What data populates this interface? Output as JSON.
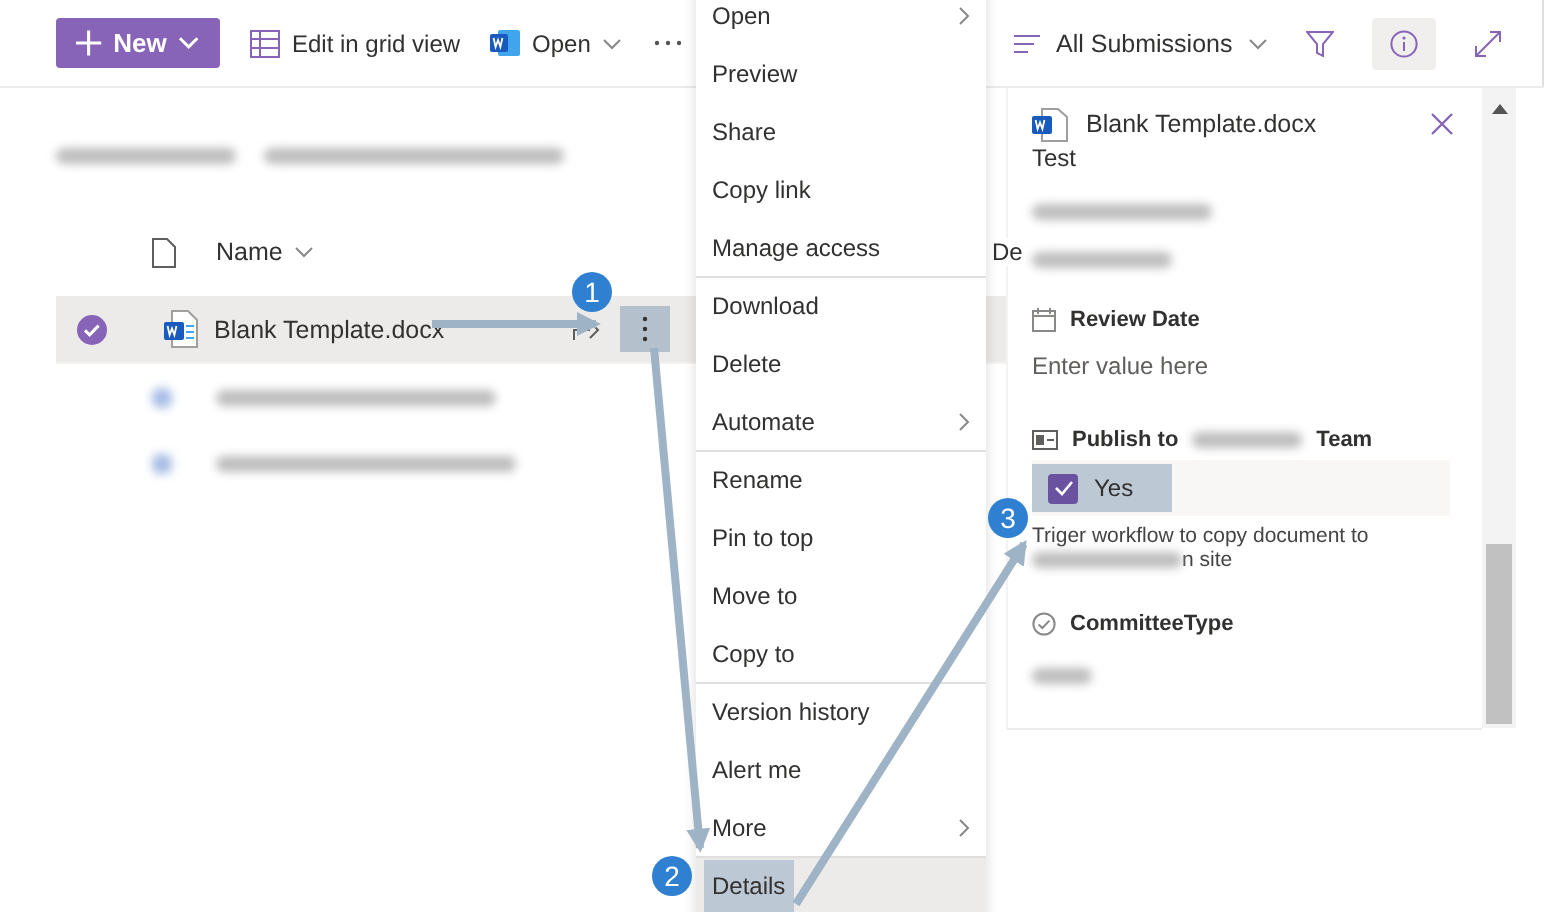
{
  "command_bar": {
    "new_button": {
      "label": "New"
    },
    "commands": [
      {
        "label": "Edit in grid view",
        "kind": "grid"
      },
      {
        "label": "Open",
        "kind": "word"
      }
    ]
  },
  "view_bar": {
    "view": "All Submissions",
    "info_selected": true
  },
  "list": {
    "columns": [
      {
        "label": "Name"
      },
      {
        "label": "De"
      }
    ],
    "rows": [
      {
        "name": "Blank Template.docx",
        "selected": true
      }
    ]
  },
  "context_menu": {
    "items": [
      {
        "label": "Open",
        "submenu": true,
        "divider_before": false,
        "selected": false
      },
      {
        "label": "Preview",
        "submenu": false,
        "divider_before": false,
        "selected": false
      },
      {
        "label": "Share",
        "submenu": false,
        "divider_before": false,
        "selected": false
      },
      {
        "label": "Copy link",
        "submenu": false,
        "divider_before": false,
        "selected": false
      },
      {
        "label": "Manage access",
        "submenu": false,
        "divider_before": false,
        "selected": false
      },
      {
        "label": "Download",
        "submenu": false,
        "divider_before": true,
        "selected": false
      },
      {
        "label": "Delete",
        "submenu": false,
        "divider_before": false,
        "selected": false
      },
      {
        "label": "Automate",
        "submenu": true,
        "divider_before": false,
        "selected": false
      },
      {
        "label": "Rename",
        "submenu": false,
        "divider_before": true,
        "selected": false
      },
      {
        "label": "Pin to top",
        "submenu": false,
        "divider_before": false,
        "selected": false
      },
      {
        "label": "Move to",
        "submenu": false,
        "divider_before": false,
        "selected": false
      },
      {
        "label": "Copy to",
        "submenu": false,
        "divider_before": false,
        "selected": false
      },
      {
        "label": "Version history",
        "submenu": false,
        "divider_before": true,
        "selected": false
      },
      {
        "label": "Alert me",
        "submenu": false,
        "divider_before": false,
        "selected": false
      },
      {
        "label": "More",
        "submenu": true,
        "divider_before": false,
        "selected": false
      },
      {
        "label": "Details",
        "submenu": false,
        "divider_before": true,
        "selected": true
      }
    ]
  },
  "details_pane": {
    "title": "Blank Template.docx",
    "value_above": "Test",
    "fields": [
      {
        "kind": "date",
        "label": "Review Date",
        "placeholder": "Enter value here"
      },
      {
        "kind": "boolean",
        "label": "Publish to",
        "label_after": "Team",
        "option": "Yes",
        "checked": true,
        "description": "Triger workflow to copy document to",
        "description_tail": "n site"
      },
      {
        "kind": "choice",
        "label": "CommitteeType"
      }
    ]
  },
  "callouts": [
    {
      "number": "1"
    },
    {
      "number": "2"
    },
    {
      "number": "3"
    }
  ]
}
